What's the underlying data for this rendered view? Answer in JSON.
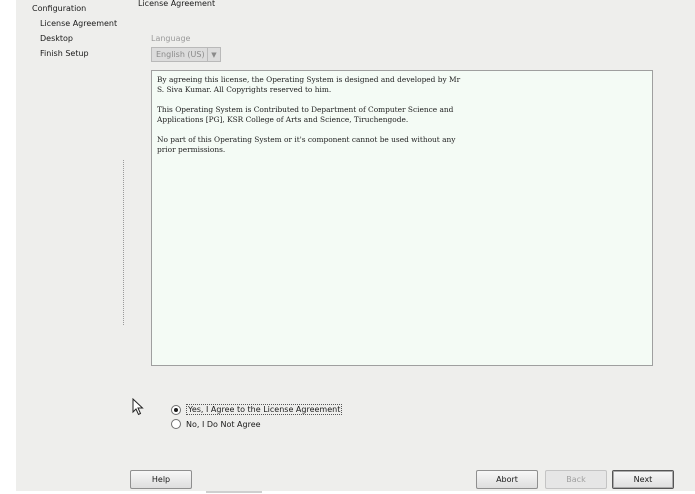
{
  "page": {
    "title": "License Agreement"
  },
  "steps": {
    "heading": "Configuration",
    "items": [
      "License Agreement",
      "Desktop",
      "Finish Setup"
    ]
  },
  "language": {
    "label": "Language",
    "selected": "English (US)"
  },
  "license": {
    "paragraphs": [
      "By agreeing this license, the Operating System is designed and developed by Mr\nS. Siva Kumar. All Copyrights reserved to him.",
      "This Operating System is Contributed to Department of Computer Science and\nApplications [PG], KSR College of Arts and Science, Tiruchengode.",
      "No part of this Operating System or it's component cannot be used without any\nprior permissions."
    ]
  },
  "options": {
    "agree": "Yes, I Agree to the License Agreement",
    "disagree": "No, I Do Not Agree"
  },
  "buttons": {
    "help": "Help",
    "abort": "Abort",
    "back": "Back",
    "next": "Next"
  }
}
